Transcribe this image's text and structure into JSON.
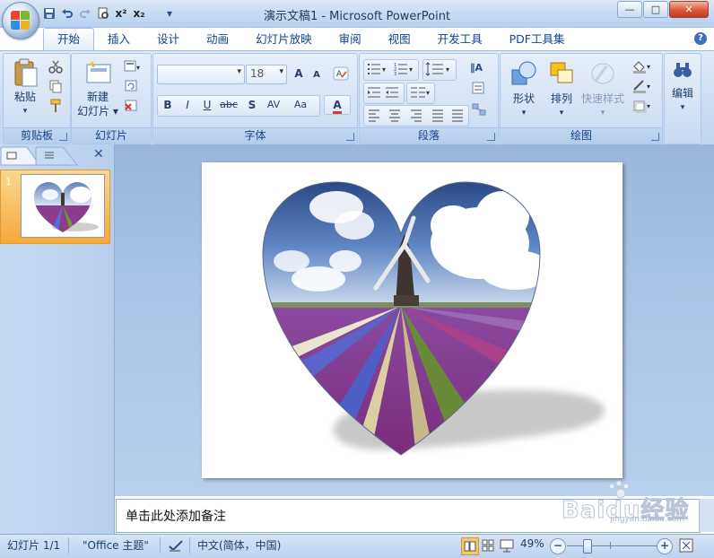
{
  "window": {
    "title": "演示文稿1 - Microsoft PowerPoint",
    "controls": {
      "minimize": "—",
      "maximize": "□",
      "close": "✕"
    }
  },
  "quick_access": [
    {
      "name": "save-icon"
    },
    {
      "name": "undo-icon"
    },
    {
      "name": "redo-icon"
    },
    {
      "name": "print-preview-icon"
    },
    {
      "name": "superscript-icon",
      "label": "x²"
    },
    {
      "name": "subscript-icon",
      "label": "x₂"
    },
    {
      "name": "customize-qat-icon",
      "label": "▾"
    }
  ],
  "tabs": [
    "开始",
    "插入",
    "设计",
    "动画",
    "幻灯片放映",
    "审阅",
    "视图",
    "开发工具",
    "PDF工具集"
  ],
  "active_tab": "开始",
  "ribbon": {
    "clipboard": {
      "label": "剪贴板",
      "paste": "粘贴"
    },
    "slides": {
      "label": "幻灯片",
      "new_slide_line1": "新建",
      "new_slide_line2": "幻灯片"
    },
    "font": {
      "label": "字体",
      "font_name": "",
      "font_size": "18",
      "bold": "B",
      "italic": "I",
      "underline": "U",
      "strike": "abc",
      "shadow": "S",
      "spacing": "AV",
      "case": "Aa",
      "color": "A",
      "grow": "A",
      "shrink": "A"
    },
    "paragraph": {
      "label": "段落"
    },
    "drawing": {
      "label": "绘图",
      "shapes": "形状",
      "arrange": "排列",
      "quick_styles": "快速样式"
    },
    "editing": {
      "label": "编辑"
    }
  },
  "left_pane": {
    "slide_number": "1"
  },
  "notes_placeholder": "单击此处添加备注",
  "status": {
    "slide": "幻灯片 1/1",
    "theme": "\"Office 主题\"",
    "language": "中文(简体，中国)",
    "zoom": "49%",
    "zoom_level": 0.49
  },
  "watermark": {
    "text": "Baidu经验",
    "url": "jingyan.baidu.com"
  },
  "colors": {
    "accent": "#15428b",
    "ribbon_bg": "#c9dbf2",
    "active_thumb": "#f5a93c"
  }
}
